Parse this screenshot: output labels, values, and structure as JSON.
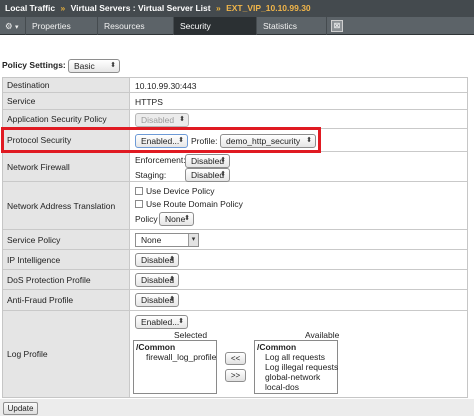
{
  "breadcrumb": {
    "root": "Local Traffic",
    "separator": "»",
    "list": "Virtual Servers : Virtual Server List",
    "current": "EXT_VIP_10.10.99.30"
  },
  "tabs": {
    "gear_glyph": "⚙",
    "gear_caret": "▾",
    "properties": "Properties",
    "resources": "Resources",
    "security": "Security",
    "statistics": "Statistics",
    "close_glyph": "⊠"
  },
  "policy_settings": {
    "label": "Policy Settings:",
    "value": "Basic"
  },
  "rows": {
    "destination": {
      "label": "Destination",
      "value": "10.10.99.30:443"
    },
    "service": {
      "label": "Service",
      "value": "HTTPS"
    },
    "app_security": {
      "label": "Application Security Policy",
      "value": "Disabled"
    },
    "protocol_security": {
      "label": "Protocol Security",
      "value": "Enabled...",
      "profile_label": "Profile:",
      "profile_value": "demo_http_security"
    },
    "network_firewall": {
      "label": "Network Firewall",
      "enforcement_label": "Enforcement:",
      "enforcement_value": "Disabled",
      "staging_label": "Staging:",
      "staging_value": "Disabled"
    },
    "nat": {
      "label": "Network Address Translation",
      "use_device_policy": "Use Device Policy",
      "use_route_domain_policy": "Use Route Domain Policy",
      "policy_label": "Policy",
      "policy_value": "None"
    },
    "service_policy": {
      "label": "Service Policy",
      "value": "None"
    },
    "ip_intelligence": {
      "label": "IP Intelligence",
      "value": "Disabled"
    },
    "dos_profile": {
      "label": "DoS Protection Profile",
      "value": "Disabled"
    },
    "anti_fraud": {
      "label": "Anti-Fraud Profile",
      "value": "Disabled"
    },
    "log_profile": {
      "label": "Log Profile",
      "value": "Enabled...",
      "selected_header": "Selected",
      "available_header": "Available",
      "selected_items": [
        "/Common",
        "firewall_log_profile"
      ],
      "available_items": [
        "/Common",
        "Log all requests",
        "Log illegal requests",
        "global-network",
        "local-dos"
      ],
      "move_left": "<<",
      "move_right": ">>"
    }
  },
  "update_button": "Update",
  "select_arrow": "⬍",
  "dropdown_arrow": "▾",
  "colors": {
    "highlight": "#e01a22",
    "breadcrumb_current": "#f0b54a",
    "tab_active": "#2b3033"
  }
}
